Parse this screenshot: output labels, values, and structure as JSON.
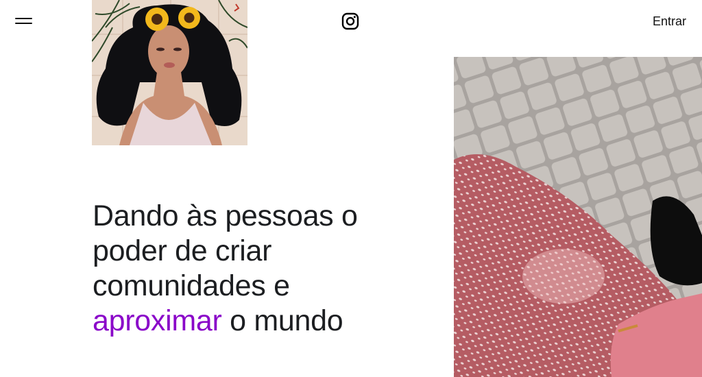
{
  "header": {
    "menu_icon": "hamburger-menu-icon",
    "logo_icon": "instagram-logo-icon",
    "login_label": "Entrar"
  },
  "hero": {
    "headline_before": "Dando às pessoas o poder de criar comunidades e ",
    "headline_accent": "aproximar",
    "headline_after": " o mundo",
    "accent_color": "#8a07c9"
  },
  "images": {
    "illustration": "illustrated-woman-with-sunflower-crown",
    "photo": "pink-patterned-dress-on-cobblestone"
  }
}
